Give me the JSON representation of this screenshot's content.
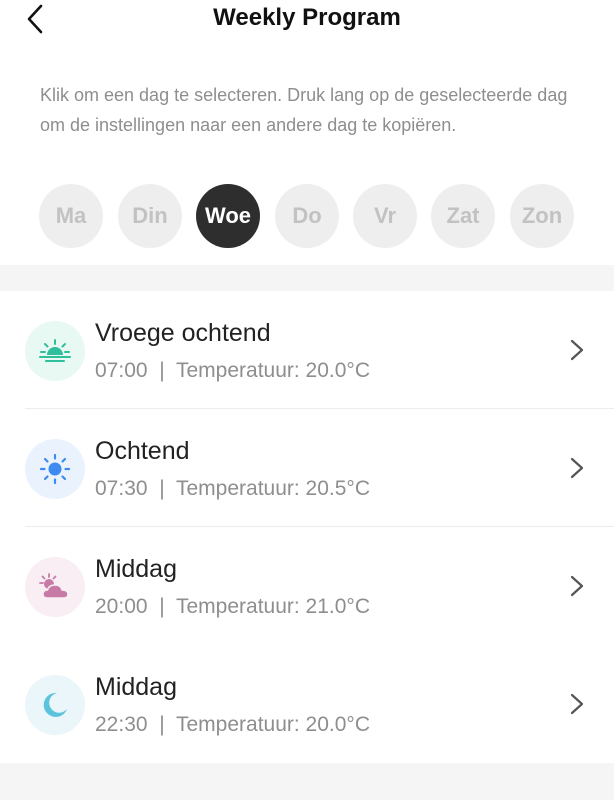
{
  "header": {
    "title": "Weekly Program",
    "back_icon": "chevron-left-icon"
  },
  "hint": "Klik om een dag te selecteren. Druk lang op de geselecteerde dag om de instellingen naar een andere dag te kopiëren.",
  "days": [
    {
      "label": "Ma",
      "selected": false
    },
    {
      "label": "Din",
      "selected": false
    },
    {
      "label": "Woe",
      "selected": true
    },
    {
      "label": "Do",
      "selected": false
    },
    {
      "label": "Vr",
      "selected": false
    },
    {
      "label": "Zat",
      "selected": false
    },
    {
      "label": "Zon",
      "selected": false
    }
  ],
  "schedule": [
    {
      "title": "Vroege ochtend",
      "time": "07:00",
      "separator": "|",
      "temp_label": "Temperatuur: 20.0°C",
      "icon": "sunrise-icon",
      "icon_color": "#2fbf9a",
      "icon_bg": "#e8f8f3"
    },
    {
      "title": "Ochtend",
      "time": "07:30",
      "separator": "|",
      "temp_label": "Temperatuur: 20.5°C",
      "icon": "sun-icon",
      "icon_color": "#3d8bf0",
      "icon_bg": "#eaf2fd"
    },
    {
      "title": "Middag",
      "time": "20:00",
      "separator": "|",
      "temp_label": "Temperatuur: 21.0°C",
      "icon": "sun-cloud-icon",
      "icon_color": "#c77aa6",
      "icon_bg": "#f8eef4"
    },
    {
      "title": "Middag",
      "time": "22:30",
      "separator": "|",
      "temp_label": "Temperatuur: 20.0°C",
      "icon": "moon-icon",
      "icon_color": "#5cc3dc",
      "icon_bg": "#eaf6fa"
    }
  ],
  "colors": {
    "accent_selected_day": "#2e2e2e",
    "background": "#f5f5f5",
    "muted_text": "#8e8e8e"
  }
}
